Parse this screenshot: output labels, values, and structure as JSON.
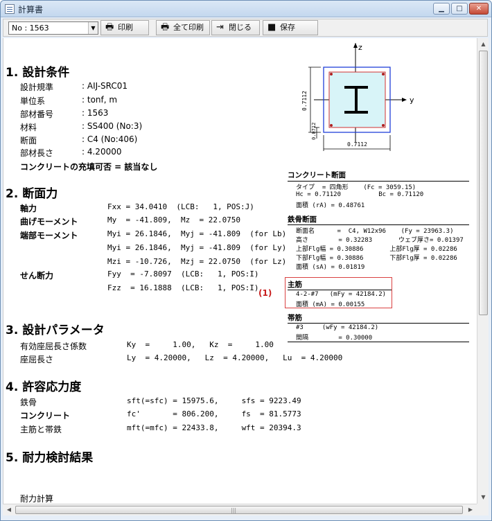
{
  "window": {
    "title": "計算書",
    "min_glyph": "▁",
    "max_glyph": "□",
    "close_glyph": "✕"
  },
  "toolbar": {
    "record_value": "No : 1563",
    "print_label": "印刷",
    "print_all_label": "全て印刷",
    "close_label": "閉じる",
    "save_label": "保存"
  },
  "sections": {
    "s1": {
      "heading": "1. 設計条件",
      "rows": [
        {
          "label": "設計規準",
          "value": ": AIJ-SRC01"
        },
        {
          "label": "単位系",
          "value": ": tonf, m"
        },
        {
          "label": "部材番号",
          "value": ": 1563"
        },
        {
          "label": "材料",
          "value": ": SS400 (No:3)"
        },
        {
          "label": "断面",
          "value": ": C4 (No:406)"
        },
        {
          "label": "部材長さ",
          "value": ": 4.20000"
        }
      ],
      "filled": "コンクリートの充填可否 = 該当なし"
    },
    "s2": {
      "heading": "2. 断面力",
      "axial_label": "軸力",
      "axial": "Fxx = 34.0410  (LCB:   1, POS:J)",
      "bending_label": "曲げモーメント",
      "bending": "My  = -41.809,  Mz  = 22.0750",
      "end_label": "端部モーメント",
      "end1": "Myi = 26.1846,  Myj = -41.809  (for Lb)",
      "end2": "Myi = 26.1846,  Myj = -41.809  (for Ly)",
      "end3": "Mzi = -10.726,  Mzj = 22.0750  (for Lz)",
      "shear_label": "せん断力",
      "shear1": "Fyy  = -7.8097  (LCB:   1, POS:I)",
      "shear2": "Fzz  = 16.1888  (LCB:   1, POS:I)"
    },
    "s3": {
      "heading": "3. 設計パラメータ",
      "k_label": "有効座屈長さ係数",
      "k_value": "Ky  =     1.00,   Kz  =     1.00",
      "l_label": "座屈長さ",
      "l_value": "Ly  = 4.20000,   Lz  = 4.20000,   Lu  = 4.20000"
    },
    "s4": {
      "heading": "4. 許容応力度",
      "rows": [
        {
          "label": "鉄骨",
          "value": "sft(=sfc) = 15975.6,     sfs = 9223.49"
        },
        {
          "label": "コンクリート",
          "value": "fc'       = 806.200,     fs  = 81.5773"
        },
        {
          "label": "主筋と帯鉄",
          "value": "mft(=mfc) = 22433.8,     wft = 20394.3"
        }
      ]
    },
    "s5": {
      "heading": "5. 耐力検討結果",
      "sub": "耐力計算"
    }
  },
  "figure": {
    "z_label": "z",
    "y_label": "y",
    "height_dim": "0.7112",
    "cover_dim": "0.0712",
    "width_dim": "0.7112"
  },
  "side": {
    "concrete": {
      "heading": "コンクリート断面",
      "l1": "タイプ  = 四角形    (Fc = 3059.15)",
      "l2": "Hc = 0.71120          Bc = 0.71120",
      "l3": "面積 (rA) = 0.48761"
    },
    "steel": {
      "heading": "鉄骨断面",
      "l1": "断面名      =  C4, W12x96    (Fy = 23963.3)",
      "l2": "高さ        = 0.32283       ウェブ厚さ= 0.01397",
      "l3": "上部Flg幅 = 0.30886       上部Flg厚 = 0.02286",
      "l4": "下部Flg幅 = 0.30886       下部Flg厚 = 0.02286",
      "l5": "面積 (sA) = 0.01819"
    },
    "main_bar": {
      "heading": "主筋",
      "l1": "4-2-#7   (mFy = 42184.2)",
      "l2": "面積 (mA) = 0.00155",
      "marker": "(1)"
    },
    "hoop": {
      "heading": "帯筋",
      "l1": "#3     (wFy = 42184.2)",
      "l2": "間隔        = 0.30000"
    }
  },
  "colors": {
    "section_outline": "#1f3fd8",
    "concrete_fill": "#d8f4f8",
    "rebar_red": "#d23030",
    "highlight_box": "#d94040"
  }
}
